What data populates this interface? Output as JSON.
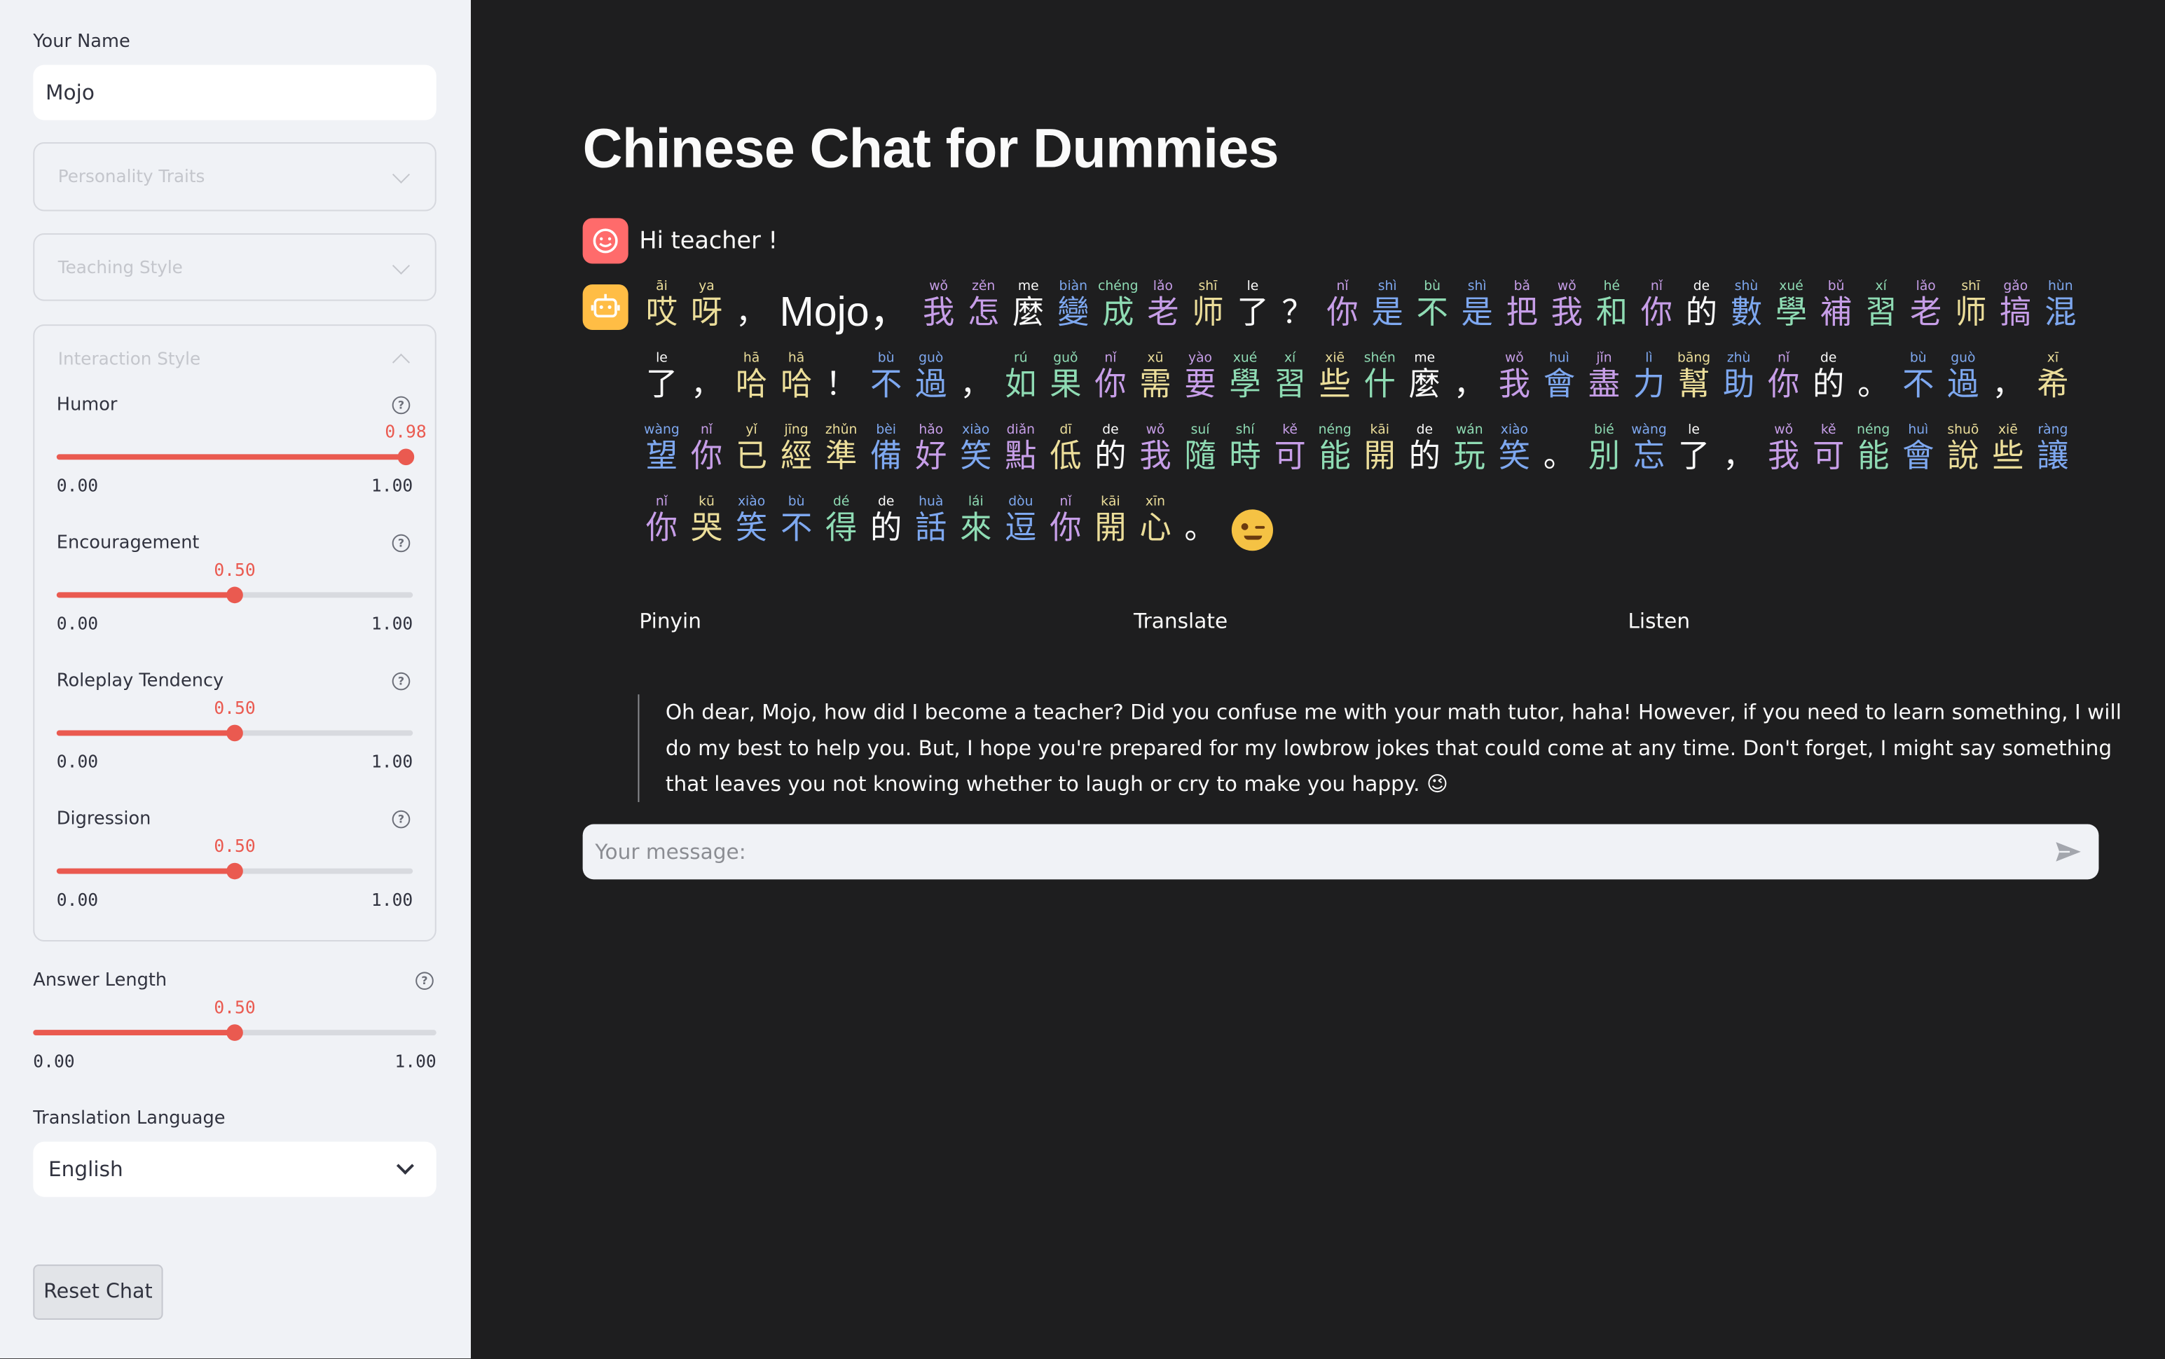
{
  "sidebar": {
    "name_label": "Your Name",
    "name_value": "Mojo",
    "personality_label": "Personality Traits",
    "teaching_label": "Teaching Style",
    "interaction_label": "Interaction Style",
    "sliders": [
      {
        "label": "Humor",
        "value": "0.98",
        "fraction": 0.98,
        "min": "0.00",
        "max": "1.00"
      },
      {
        "label": "Encouragement",
        "value": "0.50",
        "fraction": 0.5,
        "min": "0.00",
        "max": "1.00"
      },
      {
        "label": "Roleplay Tendency",
        "value": "0.50",
        "fraction": 0.5,
        "min": "0.00",
        "max": "1.00"
      },
      {
        "label": "Digression",
        "value": "0.50",
        "fraction": 0.5,
        "min": "0.00",
        "max": "1.00"
      }
    ],
    "answer_length": {
      "label": "Answer Length",
      "value": "0.50",
      "fraction": 0.5,
      "min": "0.00",
      "max": "1.00"
    },
    "translation_label": "Translation Language",
    "translation_value": "English",
    "reset_label": "Reset Chat"
  },
  "main": {
    "title": "Chinese Chat for Dummies",
    "user_message": "Hi teacher !",
    "assistant_lines": [
      [
        [
          "āi",
          "哎",
          "y"
        ],
        [
          "ya",
          "呀",
          "y"
        ],
        [
          "",
          "，",
          "w"
        ],
        [
          "",
          "Mojo，",
          "L"
        ],
        [
          "wǒ",
          "我",
          "p"
        ],
        [
          "zěn",
          "怎",
          "p"
        ],
        [
          "me",
          "麼",
          "w"
        ],
        [
          "biàn",
          "變",
          "b"
        ],
        [
          "chéng",
          "成",
          "g"
        ],
        [
          "lǎo",
          "老",
          "p"
        ],
        [
          "shī",
          "师",
          "y"
        ],
        [
          "le",
          "了",
          "w"
        ],
        [
          "",
          "？",
          "w"
        ],
        [
          "nǐ",
          "你",
          "p"
        ],
        [
          "shì",
          "是",
          "b"
        ],
        [
          "bù",
          "不",
          "g"
        ],
        [
          "shì",
          "是",
          "b"
        ],
        [
          "bǎ",
          "把",
          "p"
        ],
        [
          "wǒ",
          "我",
          "p"
        ],
        [
          "hé",
          "和",
          "g"
        ],
        [
          "nǐ",
          "你",
          "p"
        ],
        [
          "de",
          "的",
          "w"
        ],
        [
          "shù",
          "數",
          "b"
        ],
        [
          "xué",
          "學",
          "g"
        ],
        [
          "bǔ",
          "補",
          "p"
        ],
        [
          "xí",
          "習",
          "g"
        ],
        [
          "lǎo",
          "老",
          "p"
        ],
        [
          "shī",
          "师",
          "y"
        ],
        [
          "gǎo",
          "搞",
          "p"
        ],
        [
          "hùn",
          "混",
          "b"
        ]
      ],
      [
        [
          "le",
          "了",
          "w"
        ],
        [
          "",
          "，",
          "w"
        ],
        [
          "hā",
          "哈",
          "y"
        ],
        [
          "hā",
          "哈",
          "y"
        ],
        [
          "",
          "！",
          "w"
        ],
        [
          "bù",
          "不",
          "b"
        ],
        [
          "guò",
          "過",
          "b"
        ],
        [
          "",
          "，",
          "w"
        ],
        [
          "rú",
          "如",
          "g"
        ],
        [
          "guǒ",
          "果",
          "g"
        ],
        [
          "nǐ",
          "你",
          "p"
        ],
        [
          "xū",
          "需",
          "y"
        ],
        [
          "yào",
          "要",
          "p"
        ],
        [
          "xué",
          "學",
          "g"
        ],
        [
          "xí",
          "習",
          "g"
        ],
        [
          "xiē",
          "些",
          "y"
        ],
        [
          "shén",
          "什",
          "g"
        ],
        [
          "me",
          "麼",
          "w"
        ],
        [
          "",
          "，",
          "w"
        ],
        [
          "wǒ",
          "我",
          "p"
        ],
        [
          "huì",
          "會",
          "b"
        ],
        [
          "jǐn",
          "盡",
          "p"
        ],
        [
          "lì",
          "力",
          "b"
        ],
        [
          "bāng",
          "幫",
          "y"
        ],
        [
          "zhù",
          "助",
          "b"
        ],
        [
          "nǐ",
          "你",
          "p"
        ],
        [
          "de",
          "的",
          "w"
        ],
        [
          "",
          "。",
          "w"
        ],
        [
          "bù",
          "不",
          "b"
        ],
        [
          "guò",
          "過",
          "b"
        ],
        [
          "",
          "，",
          "w"
        ],
        [
          "xī",
          "希",
          "y"
        ]
      ],
      [
        [
          "wàng",
          "望",
          "b"
        ],
        [
          "nǐ",
          "你",
          "p"
        ],
        [
          "yǐ",
          "已",
          "y"
        ],
        [
          "jīng",
          "經",
          "y"
        ],
        [
          "zhǔn",
          "準",
          "y"
        ],
        [
          "bèi",
          "備",
          "b"
        ],
        [
          "hǎo",
          "好",
          "p"
        ],
        [
          "xiào",
          "笑",
          "b"
        ],
        [
          "diǎn",
          "點",
          "p"
        ],
        [
          "dī",
          "低",
          "y"
        ],
        [
          "de",
          "的",
          "w"
        ],
        [
          "wǒ",
          "我",
          "p"
        ],
        [
          "suí",
          "隨",
          "g"
        ],
        [
          "shí",
          "時",
          "g"
        ],
        [
          "kě",
          "可",
          "p"
        ],
        [
          "néng",
          "能",
          "g"
        ],
        [
          "kāi",
          "開",
          "y"
        ],
        [
          "de",
          "的",
          "w"
        ],
        [
          "wán",
          "玩",
          "g"
        ],
        [
          "xiào",
          "笑",
          "b"
        ],
        [
          "",
          "。",
          "w"
        ],
        [
          "bié",
          "別",
          "g"
        ],
        [
          "wàng",
          "忘",
          "b"
        ],
        [
          "le",
          "了",
          "w"
        ],
        [
          "",
          "，",
          "w"
        ],
        [
          "wǒ",
          "我",
          "p"
        ],
        [
          "kě",
          "可",
          "p"
        ],
        [
          "néng",
          "能",
          "g"
        ],
        [
          "huì",
          "會",
          "b"
        ],
        [
          "shuō",
          "說",
          "y"
        ],
        [
          "xiē",
          "些",
          "y"
        ],
        [
          "ràng",
          "讓",
          "b"
        ]
      ],
      [
        [
          "nǐ",
          "你",
          "p"
        ],
        [
          "kū",
          "哭",
          "y"
        ],
        [
          "xiào",
          "笑",
          "b"
        ],
        [
          "bù",
          "不",
          "b"
        ],
        [
          "dé",
          "得",
          "g"
        ],
        [
          "de",
          "的",
          "w"
        ],
        [
          "huà",
          "話",
          "b"
        ],
        [
          "lái",
          "來",
          "g"
        ],
        [
          "dòu",
          "逗",
          "b"
        ],
        [
          "nǐ",
          "你",
          "p"
        ],
        [
          "kāi",
          "開",
          "y"
        ],
        [
          "xīn",
          "心",
          "y"
        ],
        [
          "",
          "。",
          "w"
        ],
        [
          "",
          "emoji",
          "e"
        ]
      ]
    ],
    "tabs": [
      "Pinyin",
      "Translate",
      "Listen"
    ],
    "translation": "Oh dear, Mojo, how did I become a teacher? Did you confuse me with your math tutor, haha! However, if you need to learn something, I will do my best to help you. But, I hope you're prepared for my lowbrow jokes that could come at any time. Don't forget, I might say something that leaves you not knowing whether to laugh or cry to make you happy. 😉",
    "chat_placeholder": "Your message:"
  },
  "colors": {
    "accent": "#ea5a50",
    "tone_purple": "#c79ee8",
    "tone_yellow": "#ecde9a",
    "tone_blue": "#7ea8f0",
    "tone_green": "#8fdcb4",
    "neutral": "#fafafa"
  },
  "icons": {
    "user_avatar": "smiling-face-icon",
    "assistant_avatar": "robot-icon",
    "send": "paper-plane-icon",
    "help": "question-circle-icon"
  }
}
